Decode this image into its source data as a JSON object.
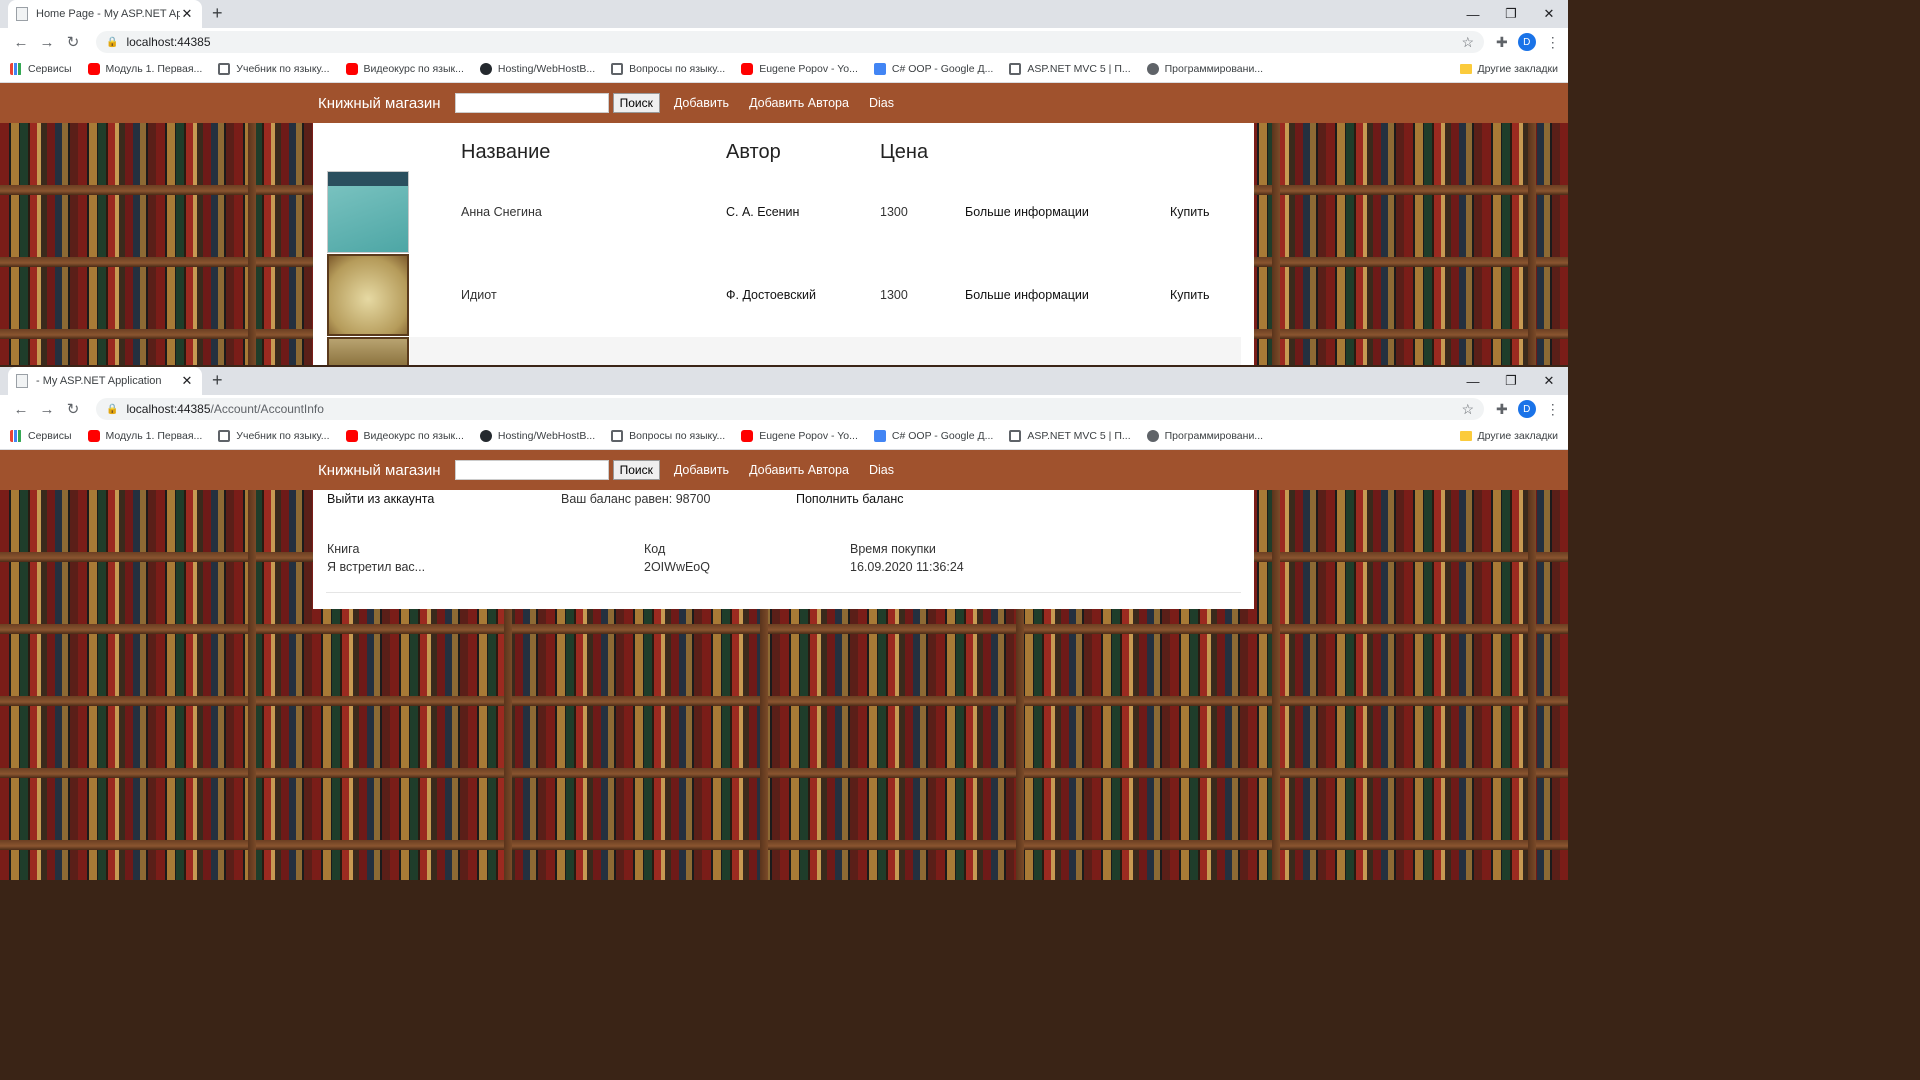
{
  "browser_top": {
    "tab_title": "Home Page - My ASP.NET Applic",
    "url": "localhost:44385",
    "url_path": ""
  },
  "browser_bottom": {
    "tab_title": "- My ASP.NET Application",
    "url": "localhost:44385",
    "url_path": "/Account/AccountInfo"
  },
  "bookmarks": [
    {
      "label": "Сервисы",
      "icon": "apps-icon"
    },
    {
      "label": "Модуль 1. Первая...",
      "icon": "youtube-icon"
    },
    {
      "label": "Учебник по языку...",
      "icon": "gmail-icon"
    },
    {
      "label": "Видеокурс по язык...",
      "icon": "youtube-icon"
    },
    {
      "label": "Hosting/WebHostB...",
      "icon": "github-icon"
    },
    {
      "label": "Вопросы по языку...",
      "icon": "gmail-icon"
    },
    {
      "label": "Eugene Popov - Yo...",
      "icon": "youtube-icon"
    },
    {
      "label": "C# OOP - Google Д...",
      "icon": "docs-icon"
    },
    {
      "label": "ASP.NET MVC 5 | П...",
      "icon": "gmail-icon"
    },
    {
      "label": "Программировани...",
      "icon": "globe-icon"
    }
  ],
  "other_bookmarks": "Другие закладки",
  "avatar_letter": "D",
  "site": {
    "brand": "Книжный магазин",
    "search_button": "Поиск",
    "nav": [
      "Добавить",
      "Добавить Автора",
      "Dias"
    ],
    "colors": {
      "navbar": "#a0522d"
    }
  },
  "books": {
    "headers": {
      "title": "Название",
      "author": "Автор",
      "price": "Цена"
    },
    "rows": [
      {
        "title": "Анна Снегина",
        "author": "С. А. Есенин",
        "price": "1300",
        "more": "Больше информации",
        "buy": "Купить"
      },
      {
        "title": "Идиот",
        "author": "Ф. Достоевский",
        "price": "1300",
        "more": "Больше информации",
        "buy": "Купить"
      }
    ]
  },
  "account": {
    "logout": "Выйти из аккаунта",
    "balance": "Ваш баланс равен: 98700",
    "topup": "Пополнить баланс",
    "headers": {
      "book": "Книга",
      "code": "Код",
      "time": "Время покупки"
    },
    "purchases": [
      {
        "book": "Я встретил вас...",
        "code": "2OIWwEoQ",
        "time": "16.09.2020 11:36:24"
      }
    ]
  }
}
